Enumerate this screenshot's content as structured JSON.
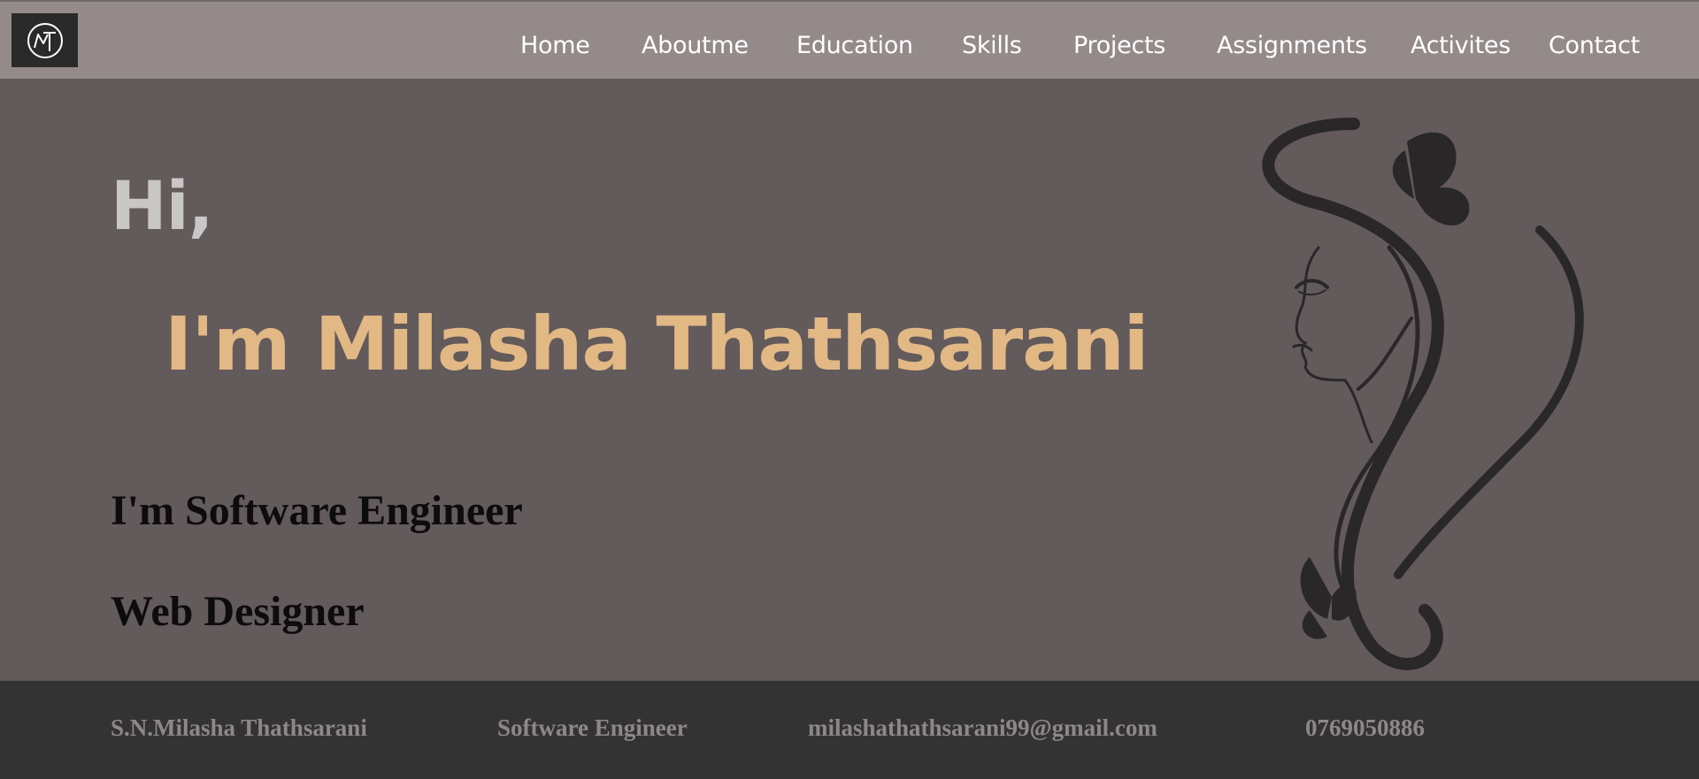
{
  "brand": {
    "logo_text": "MT"
  },
  "nav": {
    "items": [
      {
        "label": "Home"
      },
      {
        "label": "Aboutme"
      },
      {
        "label": "Education"
      },
      {
        "label": "Skills"
      },
      {
        "label": "Projects"
      },
      {
        "label": "Assignments"
      },
      {
        "label": "Activites"
      },
      {
        "label": "Contact"
      }
    ]
  },
  "hero": {
    "greeting": "Hi,",
    "name": "I'm Milasha Thathsarani",
    "roles": [
      "I'm Software Engineer",
      "Web Designer"
    ],
    "illustration": "woman-silhouette-with-butterflies"
  },
  "footer": {
    "full_name": "S.N.Milasha Thathsarani",
    "title": "Software Engineer",
    "email": "milashathathsarani99@gmail.com",
    "phone": "0769050886"
  },
  "colors": {
    "nav_bg": "#948a8a",
    "hero_bg": "#625a5b",
    "accent": "#e2b885",
    "footer_bg": "#333333",
    "footer_text": "#8f8787"
  }
}
